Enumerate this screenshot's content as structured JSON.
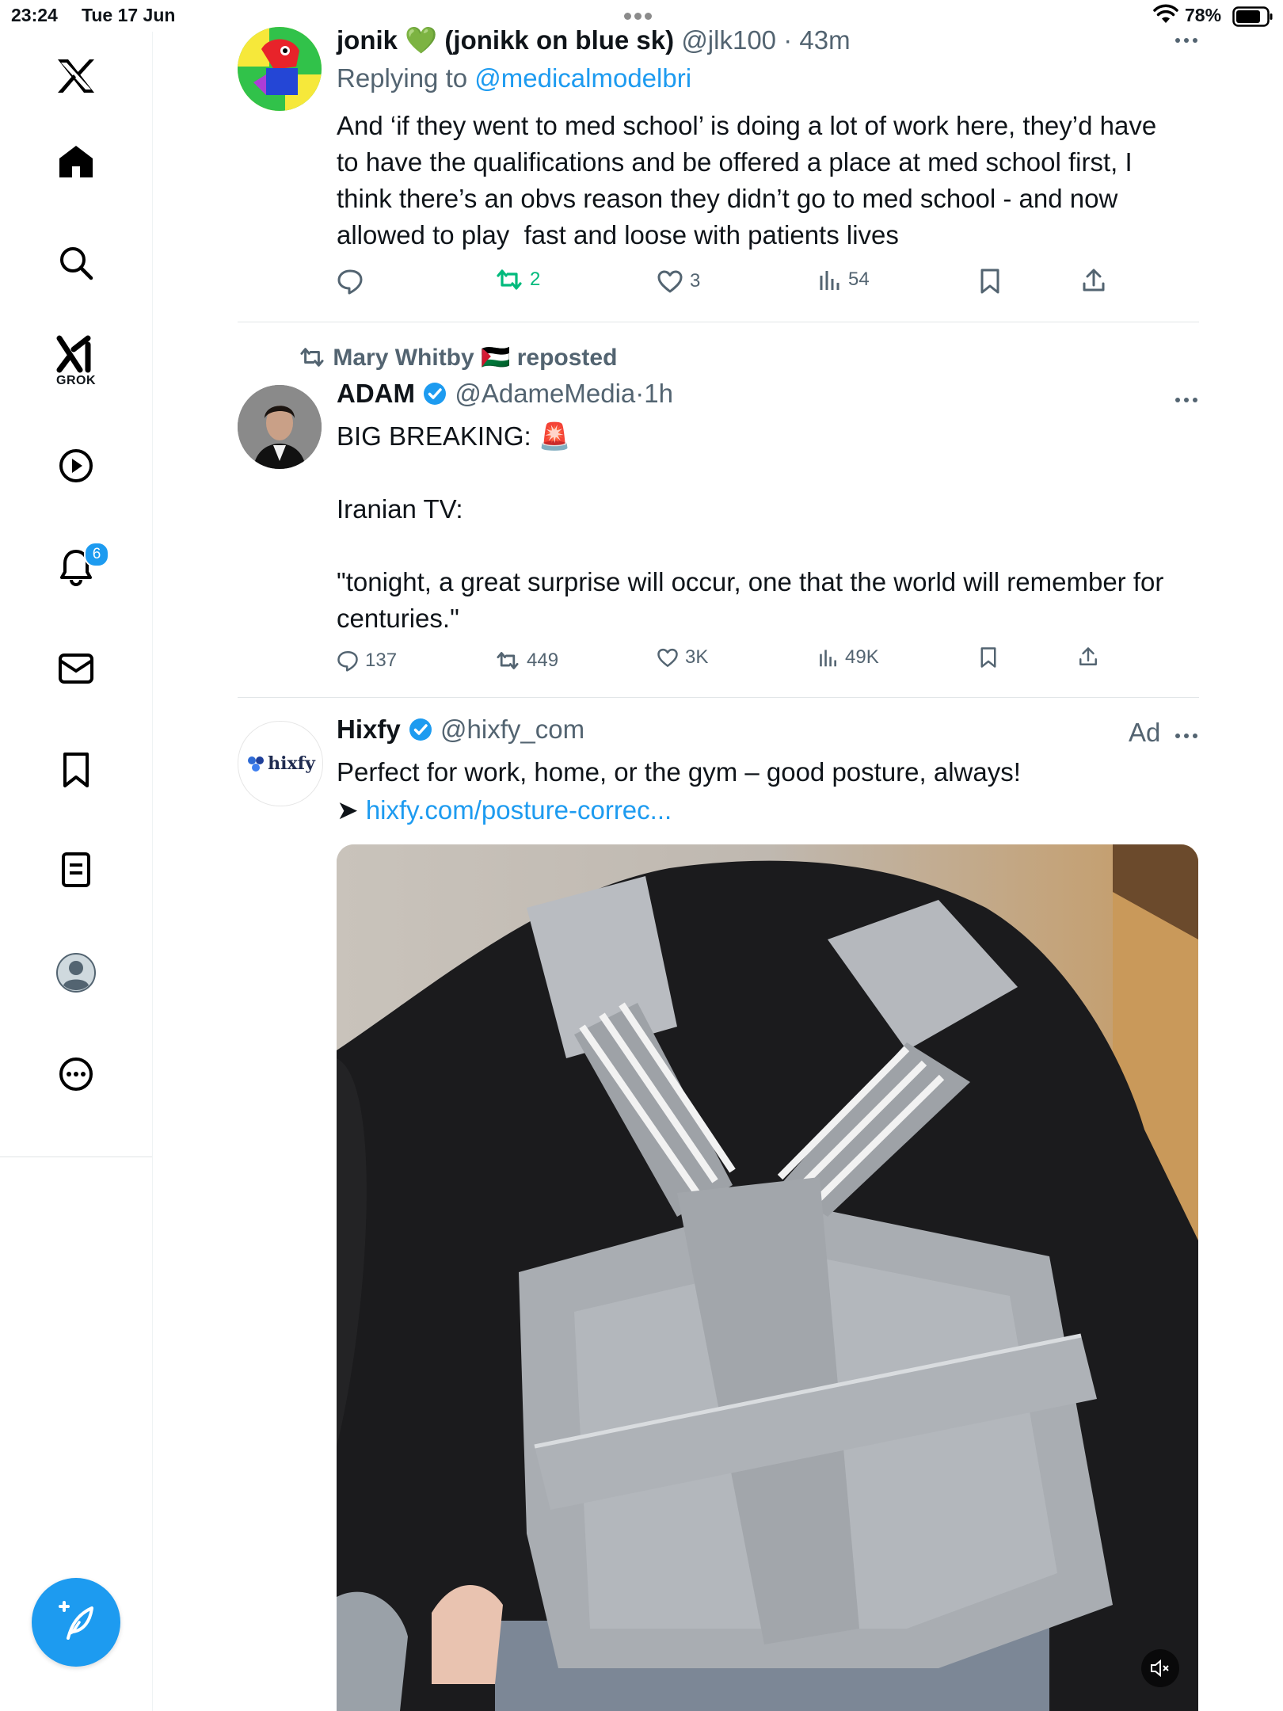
{
  "status_bar": {
    "time": "23:24",
    "date": "Tue 17 Jun",
    "battery": "78%"
  },
  "sidebar": {
    "grok_label": "GROK",
    "notifications_badge": "6"
  },
  "posts": [
    {
      "name": "jonik 💚 (jonikk on blue sk)",
      "handle": "@jlk100",
      "time": "43m",
      "replying_prefix": "Replying to ",
      "replying_to": "@medicalmodelbri",
      "text": "And ‘if they went to med school’ is doing a lot of work here, they’d have to have the qualifications and be offered a place at med school first, I think there’s an obvs reason they didn’t go to med school - and now allowed to play  fast and loose with patients lives",
      "replies": "",
      "reposts": "2",
      "likes": "3",
      "views": "54"
    },
    {
      "repost_label": "Mary Whitby 🇵🇸 reposted",
      "name": "ADAM",
      "handle": "@AdameMedia",
      "time": "1h",
      "text": "BIG BREAKING: 🚨\n\nIranian TV:\n\n\"tonight, a great surprise will occur, one that the world will remember for centuries.\"",
      "replies": "137",
      "reposts": "449",
      "likes": "3K",
      "views": "49K"
    },
    {
      "name": "Hixfy",
      "handle": "@hixfy_com",
      "ad_label": "Ad",
      "avatar_text": "hixfy",
      "text": "Perfect for work, home, or the gym – good posture, always!",
      "link_prefix": "➤ ",
      "link": "hixfy.com/posture-correc..."
    }
  ],
  "colors": {
    "accent": "#1d9bf0",
    "repost_green": "#00ba7c",
    "secondary_text": "#536471"
  }
}
